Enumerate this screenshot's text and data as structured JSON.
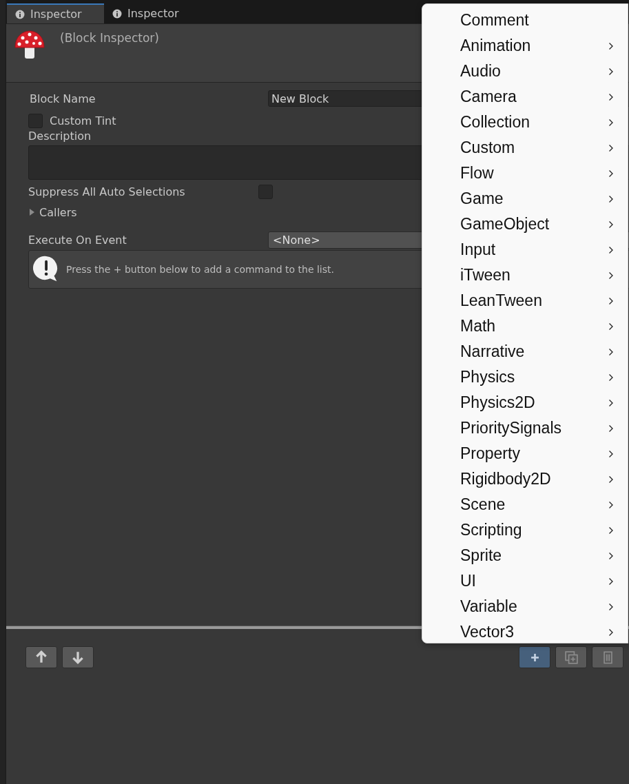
{
  "tabs": [
    {
      "label": "Inspector",
      "selected": true
    },
    {
      "label": "Inspector",
      "selected": false
    }
  ],
  "header": {
    "title": "(Block Inspector)"
  },
  "fields": {
    "block_name": {
      "label": "Block Name",
      "value": "New Block"
    },
    "custom_tint": {
      "label": "Custom Tint",
      "checked": false
    },
    "description": {
      "label": "Description"
    },
    "suppress": {
      "label": "Suppress All Auto Selections",
      "checked": false
    },
    "callers": {
      "label": "Callers",
      "expanded": false
    },
    "execute_on_event": {
      "label": "Execute On Event",
      "value": "<None>"
    }
  },
  "help_box": {
    "text": "Press the + button below to add a command to the list."
  },
  "menu": {
    "items": [
      {
        "label": "Comment",
        "submenu": false
      },
      {
        "label": "Animation",
        "submenu": true
      },
      {
        "label": "Audio",
        "submenu": true
      },
      {
        "label": "Camera",
        "submenu": true
      },
      {
        "label": "Collection",
        "submenu": true
      },
      {
        "label": "Custom",
        "submenu": true
      },
      {
        "label": "Flow",
        "submenu": true
      },
      {
        "label": "Game",
        "submenu": true
      },
      {
        "label": "GameObject",
        "submenu": true
      },
      {
        "label": "Input",
        "submenu": true
      },
      {
        "label": "iTween",
        "submenu": true
      },
      {
        "label": "LeanTween",
        "submenu": true
      },
      {
        "label": "Math",
        "submenu": true
      },
      {
        "label": "Narrative",
        "submenu": true
      },
      {
        "label": "Physics",
        "submenu": true
      },
      {
        "label": "Physics2D",
        "submenu": true
      },
      {
        "label": "PrioritySignals",
        "submenu": true
      },
      {
        "label": "Property",
        "submenu": true
      },
      {
        "label": "Rigidbody2D",
        "submenu": true
      },
      {
        "label": "Scene",
        "submenu": true
      },
      {
        "label": "Scripting",
        "submenu": true
      },
      {
        "label": "Sprite",
        "submenu": true
      },
      {
        "label": "UI",
        "submenu": true
      },
      {
        "label": "Variable",
        "submenu": true
      },
      {
        "label": "Vector3",
        "submenu": true
      }
    ]
  }
}
